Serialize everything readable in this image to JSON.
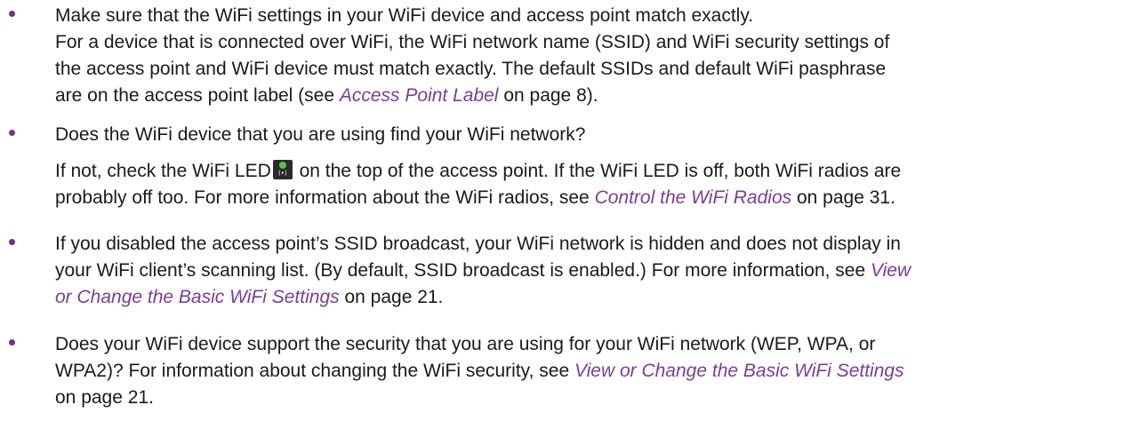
{
  "items": [
    {
      "lines": [
        "Make sure that the WiFi settings in your WiFi device and access point match exactly.",
        "For a device that is connected over WiFi, the WiFi network name (SSID) and WiFi security settings of",
        "the access point and WiFi device must match exactly. The default SSIDs and default WiFi pasphrase"
      ],
      "last_line_prefix": "are on the access point label (see ",
      "link": "Access Point Label",
      "last_line_suffix": " on page 8)."
    },
    {
      "line1": "Does the WiFi device that you are using find your WiFi network?",
      "p2_prefix": "If not, check the WiFi LED",
      "p2_suffix": " on the top of the access point. If the WiFi LED is off, both WiFi radios are",
      "p2_line2_prefix": "probably off too. For more information about the WiFi radios, see ",
      "link": "Control the WiFi Radios",
      "p2_line2_suffix": " on page 31.",
      "led_icon": "wifi-led-icon"
    },
    {
      "line1": "If you disabled the access point’s SSID broadcast, your WiFi network is hidden and does not display in",
      "line2_prefix": "your WiFi client’s scanning list. (By default, SSID broadcast is enabled.) For more information, see ",
      "link_part1": "View",
      "link_part2": "or Change the Basic WiFi Settings",
      "line3_suffix": " on page 21."
    },
    {
      "line1": "Does your WiFi device support the security that you are using for your WiFi network (WEP, WPA, or",
      "line2_prefix": "WPA2)? For information about changing the WiFi security, see ",
      "link": "View or Change the Basic WiFi Settings",
      "line3": "on page 21."
    }
  ],
  "colors": {
    "bullet": "#7a2a8c",
    "link": "#7a3d97",
    "text": "#1a1a1a"
  }
}
